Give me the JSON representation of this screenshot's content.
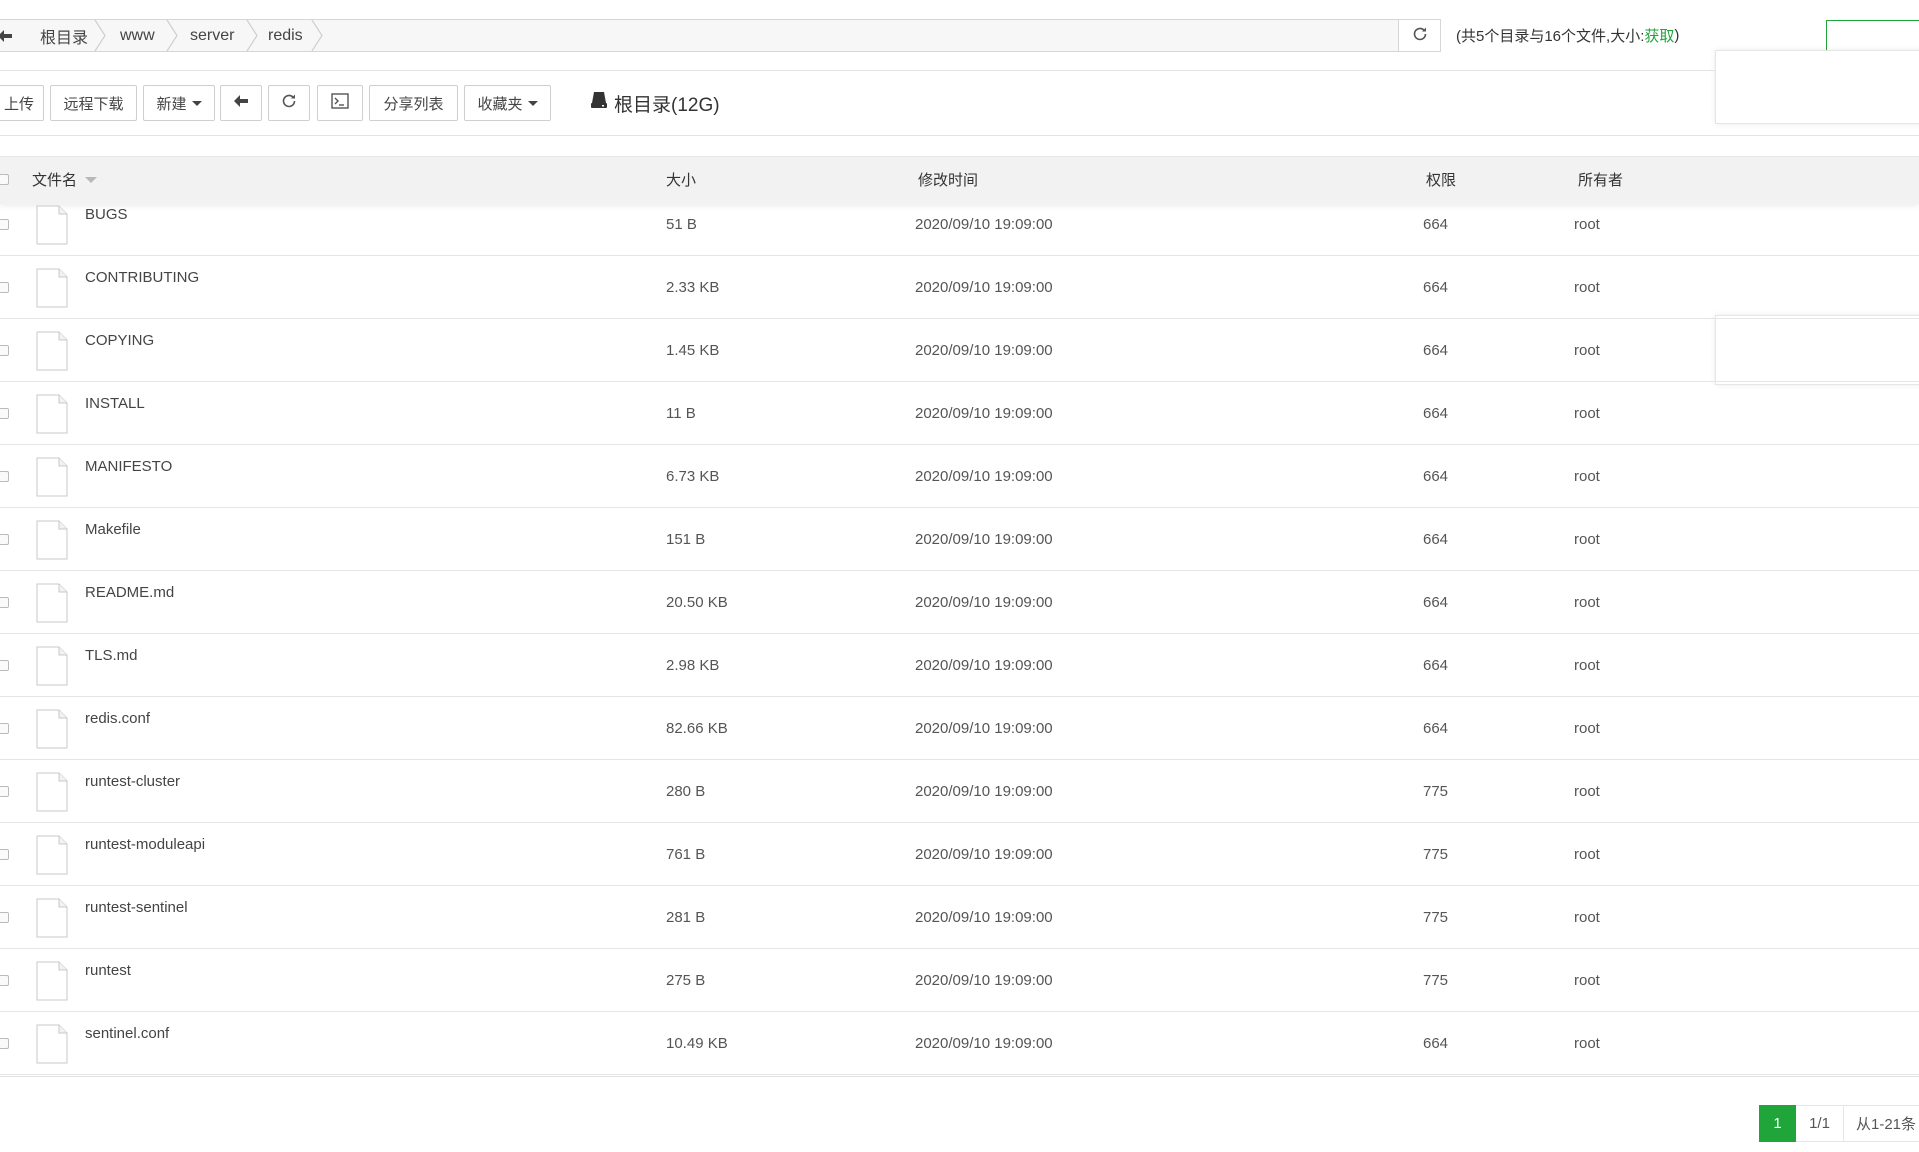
{
  "path_bar": {
    "crumbs": [
      "根目录",
      "www",
      "server",
      "redis"
    ],
    "summary_prefix": "(共5个目录与16个文件,大小: ",
    "summary_link": "获取",
    "summary_suffix": ")"
  },
  "toolbar": {
    "upload": "上传",
    "remote_download": "远程下载",
    "new": "新建",
    "share_list": "分享列表",
    "favorites": "收藏夹",
    "disk": "根目录(12G)"
  },
  "table": {
    "headers": {
      "name": "文件名",
      "size": "大小",
      "mtime": "修改时间",
      "perm": "权限",
      "owner": "所有者"
    },
    "rows": [
      {
        "name": "BUGS",
        "size": "51 B",
        "mtime": "2020/09/10 19:09:00",
        "perm": "664",
        "owner": "root"
      },
      {
        "name": "CONTRIBUTING",
        "size": "2.33 KB",
        "mtime": "2020/09/10 19:09:00",
        "perm": "664",
        "owner": "root"
      },
      {
        "name": "COPYING",
        "size": "1.45 KB",
        "mtime": "2020/09/10 19:09:00",
        "perm": "664",
        "owner": "root"
      },
      {
        "name": "INSTALL",
        "size": "11 B",
        "mtime": "2020/09/10 19:09:00",
        "perm": "664",
        "owner": "root"
      },
      {
        "name": "MANIFESTO",
        "size": "6.73 KB",
        "mtime": "2020/09/10 19:09:00",
        "perm": "664",
        "owner": "root"
      },
      {
        "name": "Makefile",
        "size": "151 B",
        "mtime": "2020/09/10 19:09:00",
        "perm": "664",
        "owner": "root"
      },
      {
        "name": "README.md",
        "size": "20.50 KB",
        "mtime": "2020/09/10 19:09:00",
        "perm": "664",
        "owner": "root"
      },
      {
        "name": "TLS.md",
        "size": "2.98 KB",
        "mtime": "2020/09/10 19:09:00",
        "perm": "664",
        "owner": "root"
      },
      {
        "name": "redis.conf",
        "size": "82.66 KB",
        "mtime": "2020/09/10 19:09:00",
        "perm": "664",
        "owner": "root"
      },
      {
        "name": "runtest-cluster",
        "size": "280 B",
        "mtime": "2020/09/10 19:09:00",
        "perm": "775",
        "owner": "root"
      },
      {
        "name": "runtest-moduleapi",
        "size": "761 B",
        "mtime": "2020/09/10 19:09:00",
        "perm": "775",
        "owner": "root"
      },
      {
        "name": "runtest-sentinel",
        "size": "281 B",
        "mtime": "2020/09/10 19:09:00",
        "perm": "775",
        "owner": "root"
      },
      {
        "name": "runtest",
        "size": "275 B",
        "mtime": "2020/09/10 19:09:00",
        "perm": "775",
        "owner": "root"
      },
      {
        "name": "sentinel.conf",
        "size": "10.49 KB",
        "mtime": "2020/09/10 19:09:00",
        "perm": "664",
        "owner": "root"
      }
    ]
  },
  "pagination": {
    "current": "1",
    "pages": "1/1",
    "range": "从1-21条"
  },
  "colors": {
    "accent": "#20a53a",
    "header_bg": "#f2f2f2",
    "divider": "#e6e6e6"
  },
  "icons": [
    "back-arrow-icon",
    "refresh-icon",
    "terminal-icon",
    "disk-icon",
    "file-icon"
  ]
}
